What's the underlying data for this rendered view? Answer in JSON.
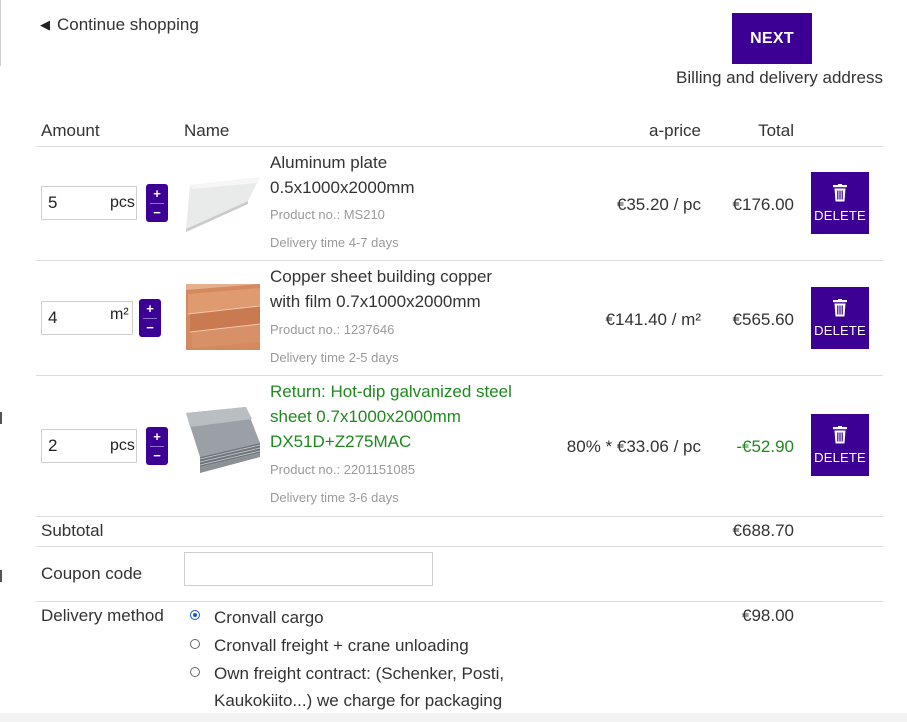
{
  "nav": {
    "continue_label": "Continue shopping",
    "next_label": "NEXT",
    "next_sub": "Billing and delivery address"
  },
  "table": {
    "headers": {
      "amount": "Amount",
      "name": "Name",
      "aprice": "a-price",
      "total": "Total"
    }
  },
  "items": [
    {
      "qty": "5",
      "unit": "pcs",
      "name_line1": "Aluminum plate",
      "name_line2": "0.5x1000x2000mm",
      "name_line3": "",
      "product_no": "Product no.: MS210",
      "delivery": "Delivery time 4-7 days",
      "aprice": "€35.20 / pc",
      "total": "€176.00",
      "delete_label": "DELETE",
      "icon": "trash-icon"
    },
    {
      "qty": "4",
      "unit": "m²",
      "name_line1": "Copper sheet building copper",
      "name_line2": "with film 0.7x1000x2000mm",
      "name_line3": "",
      "product_no": "Product no.: 1237646",
      "delivery": "Delivery time 2-5 days",
      "aprice": "€141.40 / m²",
      "total": "€565.60",
      "delete_label": "DELETE",
      "icon": "trash-icon"
    },
    {
      "qty": "2",
      "unit": "pcs",
      "name_line1": "Return: Hot-dip galvanized steel",
      "name_line2": "sheet 0.7x1000x2000mm",
      "name_line3": "DX51D+Z275MAC",
      "product_no": "Product no.: 2201151085",
      "delivery": "Delivery time 3-6 days",
      "aprice": "80% * €33.06 / pc",
      "total": "-€52.90",
      "delete_label": "DELETE",
      "icon": "trash-icon"
    }
  ],
  "stepper": {
    "plus": "+",
    "minus": "−"
  },
  "summary": {
    "subtotal_label": "Subtotal",
    "subtotal_value": "€688.70",
    "coupon_label": "Coupon code",
    "coupon_value": "",
    "delivery_label": "Delivery method",
    "delivery_value": "€98.00",
    "delivery_options": [
      {
        "label": "Cronvall cargo",
        "selected": true
      },
      {
        "label": "Cronvall freight + crane unloading",
        "selected": false
      },
      {
        "label_line1": "Own freight contract: (Schenker, Posti,",
        "label_line2": "Kaukokiito...) we charge for packaging",
        "selected": false
      }
    ]
  },
  "colors": {
    "accent": "#3d0094",
    "return_green": "#1e8a1e",
    "radio_blue": "#1a56db"
  }
}
